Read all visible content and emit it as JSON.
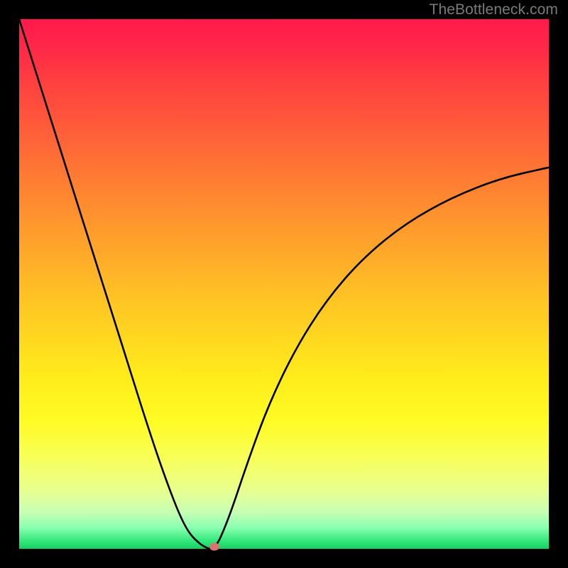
{
  "watermark": "TheBottleneck.com",
  "colors": {
    "frame": "#000000",
    "curve": "#000000",
    "marker": "#d6766e",
    "gradient_stops": [
      "#ff1a4b",
      "#ff2a48",
      "#ff4040",
      "#ff5a3a",
      "#ff7534",
      "#ff8f2f",
      "#ffa82a",
      "#ffc125",
      "#ffd720",
      "#ffed1c",
      "#fffb25",
      "#f8ff5a",
      "#e8ff8f",
      "#c8ffb4",
      "#8affb0",
      "#33e77a",
      "#17cf66"
    ]
  },
  "chart_data": {
    "type": "line",
    "title": "",
    "xlabel": "",
    "ylabel": "",
    "x_range": [
      0,
      1
    ],
    "y_range": [
      0,
      1
    ],
    "grid": false,
    "legend": false,
    "note": "V-shaped bottleneck curve; y≈0 at minimum, rising steeply toward both x extremes. Left branch starts near top-left, right branch ends ~y=0.72 at x=1. Axis values not labeled; x/y normalized 0–1.",
    "series": [
      {
        "name": "bottleneck-curve",
        "x": [
          0.0,
          0.03,
          0.06,
          0.09,
          0.12,
          0.15,
          0.18,
          0.21,
          0.24,
          0.27,
          0.3,
          0.32,
          0.34,
          0.355,
          0.363,
          0.37,
          0.38,
          0.4,
          0.43,
          0.47,
          0.52,
          0.58,
          0.65,
          0.73,
          0.82,
          0.91,
          1.0
        ],
        "y": [
          1.0,
          0.905,
          0.81,
          0.715,
          0.62,
          0.525,
          0.43,
          0.335,
          0.24,
          0.15,
          0.07,
          0.03,
          0.01,
          0.001,
          0.0,
          0.004,
          0.02,
          0.07,
          0.16,
          0.27,
          0.375,
          0.47,
          0.55,
          0.615,
          0.665,
          0.7,
          0.72
        ]
      }
    ],
    "marker": {
      "x": 0.368,
      "y": 0.004
    }
  }
}
